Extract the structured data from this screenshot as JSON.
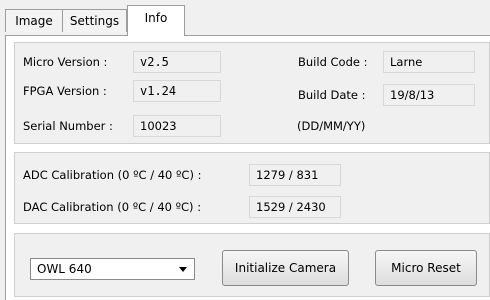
{
  "tabs": [
    {
      "label": "Image",
      "active": false
    },
    {
      "label": "Settings",
      "active": false
    },
    {
      "label": "Info",
      "active": true
    }
  ],
  "info": {
    "micro_version_label": "Micro Version :",
    "micro_version_value": "v2.5",
    "fpga_version_label": "FPGA Version :",
    "fpga_version_value": "v1.24",
    "serial_number_label": "Serial Number :",
    "serial_number_value": "10023",
    "build_code_label": "Build Code :",
    "build_code_value": "Larne",
    "build_date_label": "Build Date :",
    "build_date_value": "19/8/13",
    "date_format_hint": "(DD/MM/YY)"
  },
  "calibration": {
    "adc_label": "ADC Calibration (0 ºC / 40 ºC) :",
    "adc_value": "1279 / 831",
    "dac_label": "DAC Calibration (0 ºC / 40 ºC) :",
    "dac_value": "1529 / 2430"
  },
  "controls": {
    "camera_model_selected": "OWL 640",
    "initialize_camera_label": "Initialize Camera",
    "micro_reset_label": "Micro Reset"
  }
}
